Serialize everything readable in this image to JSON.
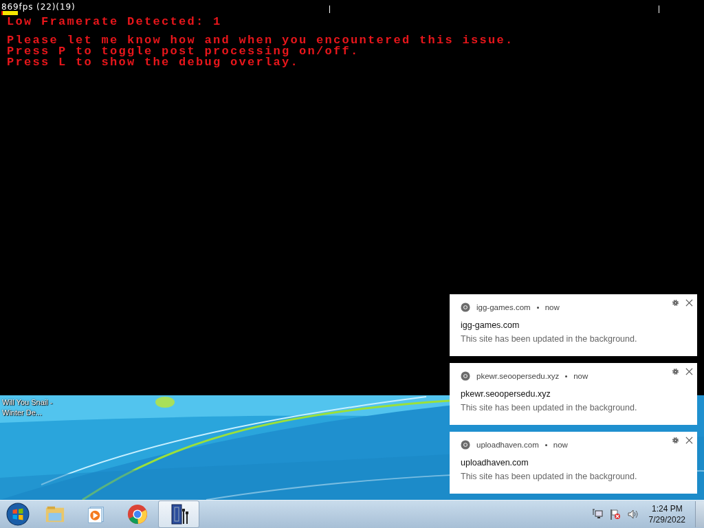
{
  "game": {
    "fps": "869fps (22)(19)",
    "warning": "Low Framerate Detected: 1",
    "messages": [
      "Please let me know how and when you encountered this issue.",
      "Press P to toggle post processing on/off.",
      "Press L to show the debug overlay."
    ]
  },
  "desktop": {
    "icons": [
      {
        "label": "Will You Snail - Winter De..."
      }
    ]
  },
  "notifications": [
    {
      "source": "igg-games.com",
      "time": "now",
      "title": "igg-games.com",
      "body": "This site has been updated in the background."
    },
    {
      "source": "pkewr.seoopersedu.xyz",
      "time": "now",
      "title": "pkewr.seoopersedu.xyz",
      "body": "This site has been updated in the background."
    },
    {
      "source": "uploadhaven.com",
      "time": "now",
      "title": "uploadhaven.com",
      "body": "This site has been updated in the background."
    }
  ],
  "taskbar": {
    "items": [
      {
        "kind": "start",
        "selected": false
      },
      {
        "kind": "folder",
        "selected": false
      },
      {
        "kind": "media",
        "selected": false
      },
      {
        "kind": "browser",
        "selected": false
      },
      {
        "kind": "app",
        "selected": true
      }
    ],
    "tray": [
      {
        "kind": "network"
      },
      {
        "kind": "flag"
      },
      {
        "kind": "volume"
      }
    ],
    "clock": {
      "time": "1:24 PM",
      "date": "7/29/2022"
    }
  }
}
